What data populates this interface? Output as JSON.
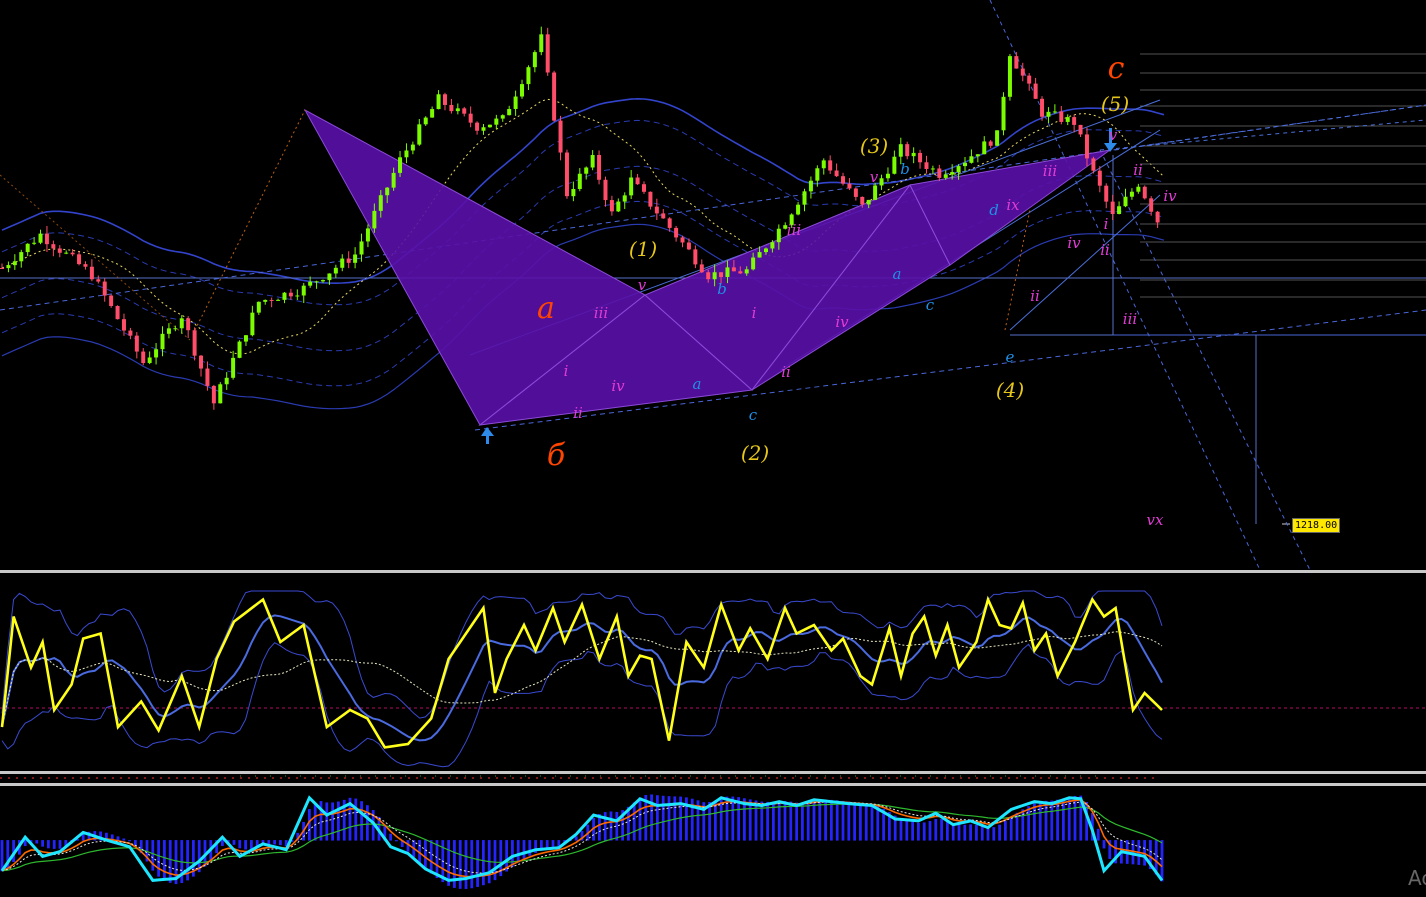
{
  "chart_data": {
    "type": "candlestick",
    "price_tag": "1218.00",
    "colors": {
      "bull": "#7CFC00",
      "bear": "#FF4D6A",
      "harmonic_fill": "#5A0FA8",
      "wave_major": "#FF4500",
      "wave_primary": "#E6C619",
      "wave_minor": "#E13BD5",
      "wave_sub": "#1E90E6",
      "rsi_line": "#FFFF1A",
      "macd_fast": "#1EE6FF",
      "macd_signal": "#FF6A00",
      "macd_slow": "#2DB82D",
      "histogram": "#2424FF"
    },
    "wave_labels": [
      {
        "text": "c",
        "tier": "major"
      },
      {
        "text": "a",
        "tier": "major"
      },
      {
        "text": "б",
        "tier": "major"
      },
      {
        "text": "(1)",
        "tier": "primary"
      },
      {
        "text": "(2)",
        "tier": "primary"
      },
      {
        "text": "(3)",
        "tier": "primary"
      },
      {
        "text": "(4)",
        "tier": "primary"
      },
      {
        "text": "(5)",
        "tier": "primary"
      },
      {
        "text": "iii",
        "tier": "minor"
      },
      {
        "text": "ii",
        "tier": "minor"
      },
      {
        "text": "iv",
        "tier": "minor"
      },
      {
        "text": "v",
        "tier": "minor"
      },
      {
        "text": "i",
        "tier": "minor"
      },
      {
        "text": "ii",
        "tier": "minor"
      },
      {
        "text": "iii",
        "tier": "minor"
      },
      {
        "text": "iv",
        "tier": "minor"
      },
      {
        "text": "v",
        "tier": "minor"
      },
      {
        "text": "iii",
        "tier": "minor"
      },
      {
        "text": "ix",
        "tier": "minor"
      },
      {
        "text": "ii",
        "tier": "minor"
      },
      {
        "text": "iv",
        "tier": "minor"
      },
      {
        "text": "i",
        "tier": "minor"
      },
      {
        "text": "v",
        "tier": "minor"
      },
      {
        "text": "ii",
        "tier": "minor"
      },
      {
        "text": "iv",
        "tier": "minor"
      },
      {
        "text": "iii",
        "tier": "minor"
      },
      {
        "text": "vx",
        "tier": "minor"
      },
      {
        "text": "i",
        "tier": "minor"
      },
      {
        "text": "ii",
        "tier": "minor"
      },
      {
        "text": "a",
        "tier": "sub"
      },
      {
        "text": "b",
        "tier": "sub"
      },
      {
        "text": "c",
        "tier": "sub"
      },
      {
        "text": "a",
        "tier": "sub"
      },
      {
        "text": "b",
        "tier": "sub"
      },
      {
        "text": "c",
        "tier": "sub"
      },
      {
        "text": "d",
        "tier": "sub"
      },
      {
        "text": "e",
        "tier": "sub"
      }
    ],
    "price_pivots": [
      [
        0,
        220
      ],
      [
        6,
        245
      ],
      [
        14,
        215
      ],
      [
        22,
        150
      ],
      [
        28,
        185
      ],
      [
        33,
        120
      ],
      [
        40,
        195
      ],
      [
        47,
        205
      ],
      [
        55,
        230
      ],
      [
        62,
        300
      ],
      [
        68,
        345
      ],
      [
        74,
        325
      ],
      [
        78,
        330
      ],
      [
        84,
        390
      ],
      [
        88,
        275
      ],
      [
        92,
        300
      ],
      [
        95,
        260
      ],
      [
        98,
        285
      ],
      [
        104,
        250
      ],
      [
        110,
        215
      ],
      [
        116,
        218
      ],
      [
        122,
        255
      ],
      [
        128,
        300
      ],
      [
        134,
        265
      ],
      [
        140,
        308
      ],
      [
        146,
        290
      ],
      [
        150,
        300
      ],
      [
        155,
        318
      ],
      [
        157,
        380
      ],
      [
        162,
        335
      ],
      [
        167,
        328
      ],
      [
        170,
        290
      ],
      [
        173,
        258
      ],
      [
        177,
        283
      ],
      [
        180,
        255
      ]
    ],
    "rsi_pivots": [
      [
        0,
        20
      ],
      [
        2,
        85
      ],
      [
        5,
        55
      ],
      [
        7,
        70
      ],
      [
        9,
        30
      ],
      [
        12,
        45
      ],
      [
        14,
        72
      ],
      [
        17,
        75
      ],
      [
        20,
        20
      ],
      [
        24,
        35
      ],
      [
        27,
        18
      ],
      [
        31,
        50
      ],
      [
        34,
        20
      ],
      [
        37,
        60
      ],
      [
        40,
        82
      ],
      [
        45,
        95
      ],
      [
        48,
        70
      ],
      [
        52,
        80
      ],
      [
        56,
        20
      ],
      [
        60,
        30
      ],
      [
        63,
        25
      ],
      [
        66,
        8
      ],
      [
        70,
        10
      ],
      [
        74,
        25
      ],
      [
        77,
        60
      ],
      [
        80,
        75
      ],
      [
        83,
        90
      ],
      [
        85,
        40
      ],
      [
        87,
        60
      ],
      [
        90,
        80
      ],
      [
        92,
        65
      ],
      [
        95,
        90
      ],
      [
        97,
        70
      ],
      [
        100,
        92
      ],
      [
        103,
        60
      ],
      [
        106,
        85
      ],
      [
        108,
        50
      ],
      [
        110,
        62
      ],
      [
        112,
        60
      ],
      [
        115,
        12
      ],
      [
        118,
        70
      ],
      [
        121,
        55
      ],
      [
        124,
        92
      ],
      [
        127,
        65
      ],
      [
        129,
        78
      ],
      [
        132,
        60
      ],
      [
        135,
        90
      ],
      [
        137,
        75
      ],
      [
        140,
        80
      ],
      [
        143,
        65
      ],
      [
        145,
        72
      ],
      [
        148,
        50
      ],
      [
        150,
        45
      ],
      [
        153,
        78
      ],
      [
        155,
        50
      ],
      [
        157,
        75
      ],
      [
        159,
        85
      ],
      [
        161,
        62
      ],
      [
        163,
        80
      ],
      [
        165,
        55
      ],
      [
        168,
        70
      ],
      [
        170,
        95
      ],
      [
        172,
        80
      ],
      [
        174,
        78
      ],
      [
        176,
        93
      ],
      [
        178,
        65
      ],
      [
        180,
        75
      ],
      [
        182,
        50
      ],
      [
        185,
        70
      ],
      [
        188,
        95
      ],
      [
        190,
        85
      ],
      [
        192,
        90
      ],
      [
        195,
        30
      ],
      [
        197,
        40
      ],
      [
        200,
        30
      ]
    ],
    "macd_pivots": [
      [
        0,
        20
      ],
      [
        4,
        55
      ],
      [
        7,
        35
      ],
      [
        10,
        40
      ],
      [
        14,
        60
      ],
      [
        18,
        52
      ],
      [
        22,
        45
      ],
      [
        26,
        10
      ],
      [
        30,
        12
      ],
      [
        34,
        30
      ],
      [
        38,
        55
      ],
      [
        41,
        35
      ],
      [
        45,
        48
      ],
      [
        49,
        42
      ],
      [
        53,
        96
      ],
      [
        56,
        78
      ],
      [
        60,
        90
      ],
      [
        64,
        70
      ],
      [
        67,
        45
      ],
      [
        70,
        38
      ],
      [
        73,
        22
      ],
      [
        77,
        10
      ],
      [
        80,
        12
      ],
      [
        84,
        18
      ],
      [
        88,
        35
      ],
      [
        92,
        42
      ],
      [
        96,
        44
      ],
      [
        99,
        58
      ],
      [
        102,
        78
      ],
      [
        106,
        72
      ],
      [
        110,
        95
      ],
      [
        113,
        88
      ],
      [
        117,
        90
      ],
      [
        121,
        84
      ],
      [
        124,
        96
      ],
      [
        128,
        90
      ],
      [
        131,
        88
      ],
      [
        134,
        92
      ],
      [
        137,
        88
      ],
      [
        140,
        94
      ],
      [
        143,
        92
      ],
      [
        146,
        90
      ],
      [
        150,
        88
      ],
      [
        154,
        74
      ],
      [
        158,
        72
      ],
      [
        161,
        80
      ],
      [
        164,
        68
      ],
      [
        167,
        72
      ],
      [
        170,
        65
      ],
      [
        174,
        84
      ],
      [
        178,
        92
      ],
      [
        181,
        90
      ],
      [
        184,
        96
      ],
      [
        186,
        95
      ],
      [
        188,
        62
      ],
      [
        190,
        20
      ],
      [
        193,
        40
      ],
      [
        197,
        35
      ],
      [
        200,
        10
      ]
    ]
  }
}
